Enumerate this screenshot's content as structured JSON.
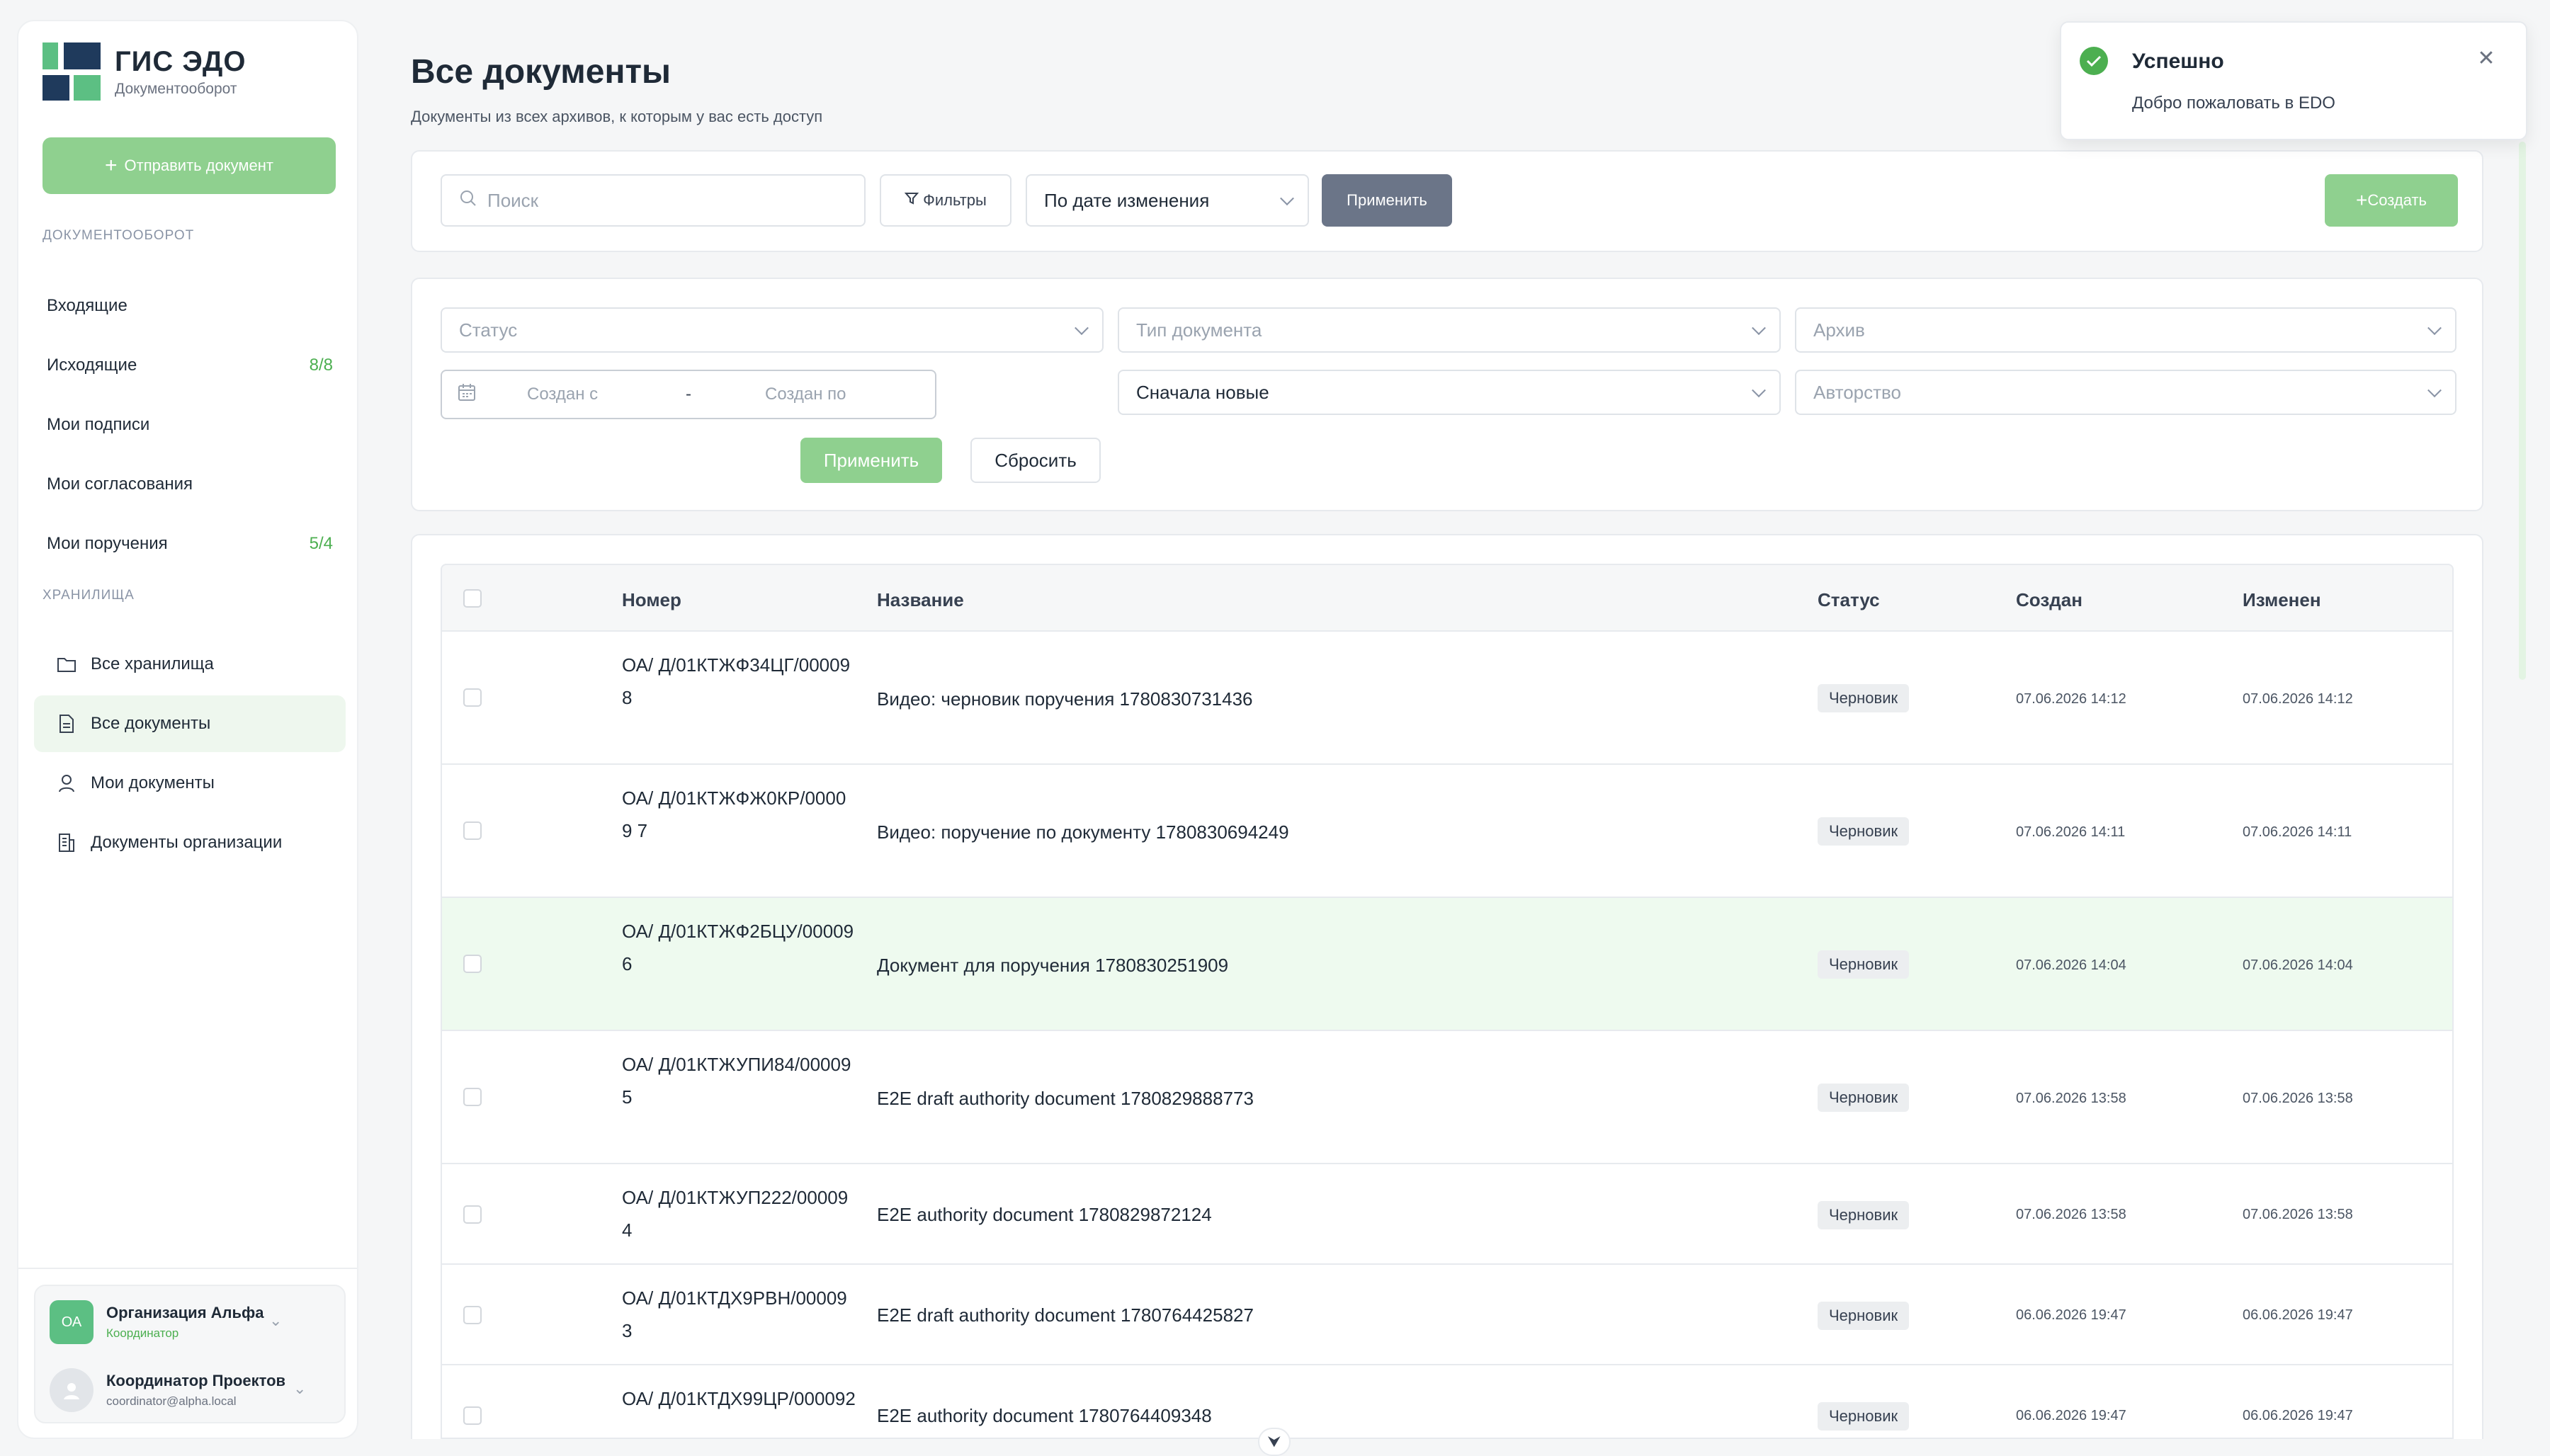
{
  "brand": {
    "title": "ГИС ЭДО",
    "subtitle": "Документооборот"
  },
  "sidebar": {
    "send_button": "Отправить документ",
    "section_docflow": "ДОКУМЕНТООБОРОТ",
    "docflow_items": [
      {
        "label": "Входящие",
        "count": ""
      },
      {
        "label": "Исходящие",
        "count": "8/8"
      },
      {
        "label": "Мои подписи",
        "count": ""
      },
      {
        "label": "Мои согласования",
        "count": ""
      },
      {
        "label": "Мои поручения",
        "count": "5/4"
      }
    ],
    "section_storage": "ХРАНИЛИЩА",
    "storage_items": [
      {
        "label": "Все хранилища",
        "icon": "folder-icon"
      },
      {
        "label": "Все документы",
        "icon": "document-icon"
      },
      {
        "label": "Мои документы",
        "icon": "user-icon"
      },
      {
        "label": "Документы организации",
        "icon": "building-icon"
      }
    ],
    "org": {
      "avatar": "ОА",
      "name": "Организация Альфа",
      "role": "Координатор"
    },
    "user": {
      "name": "Координатор Проектов",
      "email": "coordinator@alpha.local"
    }
  },
  "header": {
    "title": "Все документы",
    "subtitle": "Документы из всех архивов, к которым у вас есть доступ"
  },
  "toolbar": {
    "search_placeholder": "Поиск",
    "filters_label": "Фильтры",
    "sort_value": "По дате изменения",
    "apply_label": "Применить",
    "create_label": "Создать"
  },
  "filters": {
    "status_placeholder": "Статус",
    "doctype_placeholder": "Тип документа",
    "archive_placeholder": "Архив",
    "created_from": "Создан с",
    "created_to": "Создан по",
    "date_sep": "-",
    "order_value": "Сначала новые",
    "authorship_placeholder": "Авторство",
    "apply_label": "Применить",
    "reset_label": "Сбросить"
  },
  "table": {
    "columns": [
      "Номер",
      "Название",
      "Статус",
      "Создан",
      "Изменен"
    ],
    "rows": [
      {
        "number": "ОА/ Д/01КТЖФ34ЦГ/00009 8",
        "name": "Видео: черновик поручения 1780830731436",
        "status": "Черновик",
        "created": "07.06.2026 14:12",
        "modified": "07.06.2026 14:12"
      },
      {
        "number": "ОА/ Д/01КТЖФЖ0КР/00009 7",
        "name": "Видео: поручение по документу 1780830694249",
        "status": "Черновик",
        "created": "07.06.2026 14:11",
        "modified": "07.06.2026 14:11"
      },
      {
        "number": "ОА/ Д/01КТЖФ2БЦУ/00009 6",
        "name": "Документ для поручения 1780830251909",
        "status": "Черновик",
        "created": "07.06.2026 14:04",
        "modified": "07.06.2026 14:04"
      },
      {
        "number": "ОА/ Д/01КТЖУПИ84/00009 5",
        "name": "E2E draft authority document 1780829888773",
        "status": "Черновик",
        "created": "07.06.2026 13:58",
        "modified": "07.06.2026 13:58"
      },
      {
        "number": "ОА/ Д/01КТЖУП222/000094",
        "name": "E2E authority document 1780829872124",
        "status": "Черновик",
        "created": "07.06.2026 13:58",
        "modified": "07.06.2026 13:58"
      },
      {
        "number": "ОА/ Д/01КТДХ9РВН/000093",
        "name": "E2E draft authority document 1780764425827",
        "status": "Черновик",
        "created": "06.06.2026 19:47",
        "modified": "06.06.2026 19:47"
      },
      {
        "number": "ОА/ Д/01КТДХ99ЦР/000092",
        "name": "E2E authority document 1780764409348",
        "status": "Черновик",
        "created": "06.06.2026 19:47",
        "modified": "06.06.2026 19:47"
      }
    ]
  },
  "toast": {
    "title": "Успешно",
    "message": "Добро пожаловать в EDO"
  },
  "colors": {
    "accent": "#4caf50",
    "accent_light": "#8fd08f",
    "apply_dark": "#6b7588"
  }
}
